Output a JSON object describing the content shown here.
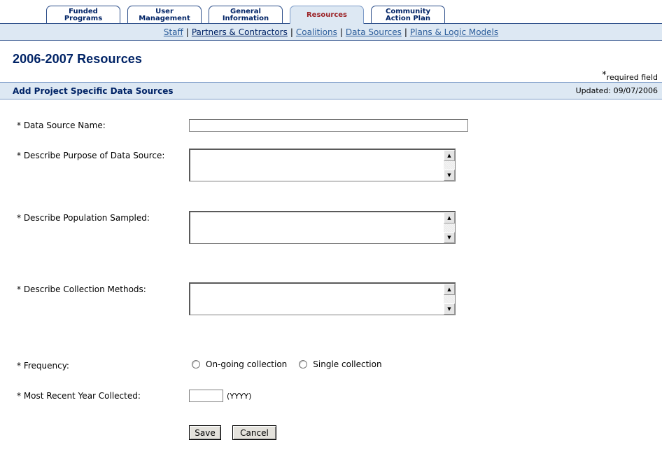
{
  "tabs": [
    {
      "label": "Funded\nPrograms",
      "active": false
    },
    {
      "label": "User\nManagement",
      "active": false
    },
    {
      "label": "General\nInformation",
      "active": false
    },
    {
      "label": "Resources",
      "active": true
    },
    {
      "label": "Community\nAction Plan",
      "active": false
    }
  ],
  "subnav": [
    {
      "label": "Staff"
    },
    {
      "label": "Partners & Contractors"
    },
    {
      "label": "Coalitions"
    },
    {
      "label": "Data Sources"
    },
    {
      "label": "Plans & Logic Models"
    }
  ],
  "subnav_separator": "|",
  "page_title": "2006-2007 Resources",
  "required_note": {
    "star": "*",
    "text": "required field"
  },
  "section": {
    "title": "Add Project Specific Data Sources",
    "updated": "Updated: 09/07/2006"
  },
  "form": {
    "data_source_name": {
      "label": "* Data Source Name:",
      "value": ""
    },
    "purpose": {
      "label": "* Describe Purpose of Data Source:",
      "value": ""
    },
    "population": {
      "label": "* Describe Population Sampled:",
      "value": ""
    },
    "methods": {
      "label": "* Describe Collection Methods:",
      "value": ""
    },
    "frequency": {
      "label": "* Frequency:",
      "options": [
        "On-going collection",
        "Single collection"
      ]
    },
    "year": {
      "label": "* Most Recent Year Collected:",
      "value": "",
      "hint": "(YYYY)"
    }
  },
  "buttons": {
    "save": "Save",
    "cancel": "Cancel"
  },
  "icons": {
    "scroll_up": "up-arrow-icon",
    "scroll_down": "down-arrow-icon"
  }
}
